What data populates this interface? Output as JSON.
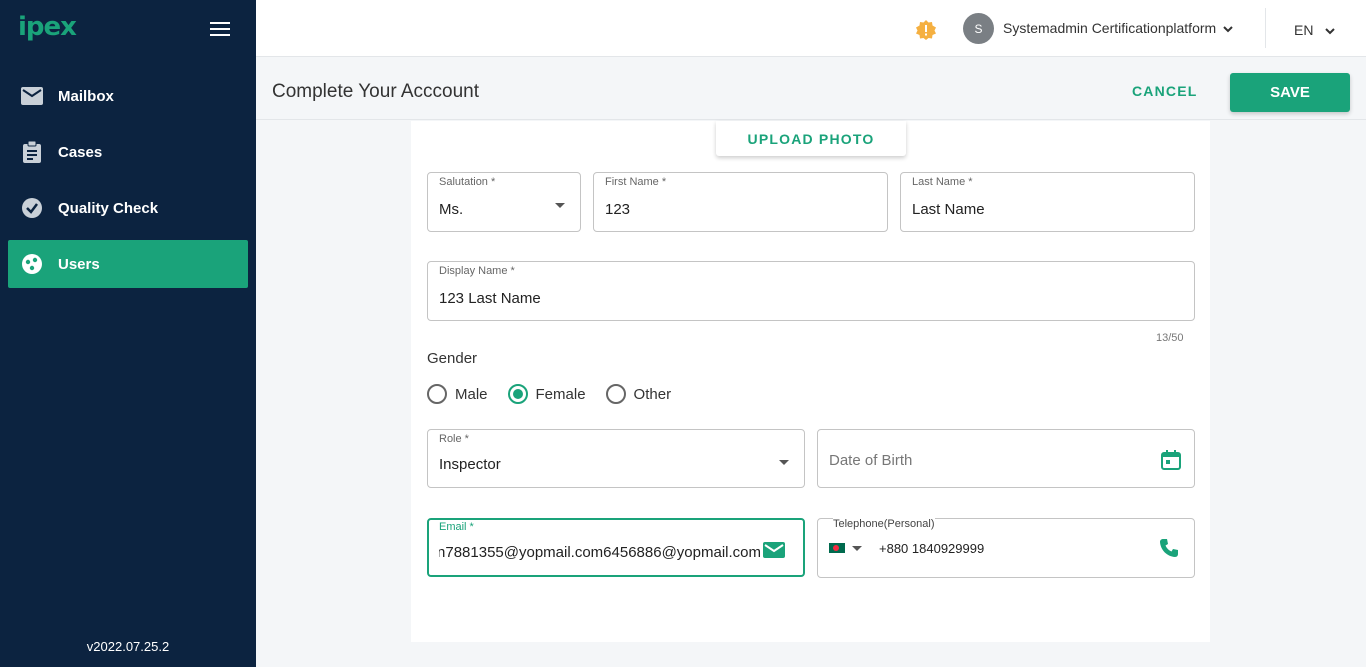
{
  "app": {
    "logo": "ipex",
    "version": "v2022.07.25.2",
    "accent_color": "#1aa37a",
    "sidebar_color": "#0c2340"
  },
  "sidebar": {
    "items": [
      {
        "label": "Mailbox",
        "icon": "mail-icon",
        "active": false
      },
      {
        "label": "Cases",
        "icon": "clipboard-icon",
        "active": false
      },
      {
        "label": "Quality Check",
        "icon": "check-circle-icon",
        "active": false
      },
      {
        "label": "Users",
        "icon": "users-icon",
        "active": true
      }
    ]
  },
  "topbar": {
    "avatar_initial": "S",
    "user_name": "Systemadmin Certificationplatform",
    "language": "EN"
  },
  "header": {
    "title": "Complete Your Acccount",
    "cancel_label": "CANCEL",
    "save_label": "SAVE"
  },
  "form": {
    "upload_label": "UPLOAD PHOTO",
    "salutation": {
      "label": "Salutation *",
      "value": "Ms."
    },
    "first_name": {
      "label": "First Name *",
      "value": "123"
    },
    "last_name": {
      "label": "Last Name *",
      "value": "Last Name"
    },
    "display_name": {
      "label": "Display Name *",
      "value": "123 Last Name",
      "counter": "13/50"
    },
    "gender": {
      "label": "Gender",
      "options": [
        "Male",
        "Female",
        "Other"
      ],
      "selected": "Female"
    },
    "role": {
      "label": "Role *",
      "value": "Inspector"
    },
    "dob": {
      "placeholder": "Date of Birth"
    },
    "email": {
      "label": "Email *",
      "value": "n7881355@yopmail.com6456886@yopmail.com"
    },
    "telephone": {
      "label": "Telephone(Personal)",
      "value": "+880 1840929999",
      "country_flag": "bangladesh-flag-icon"
    }
  }
}
